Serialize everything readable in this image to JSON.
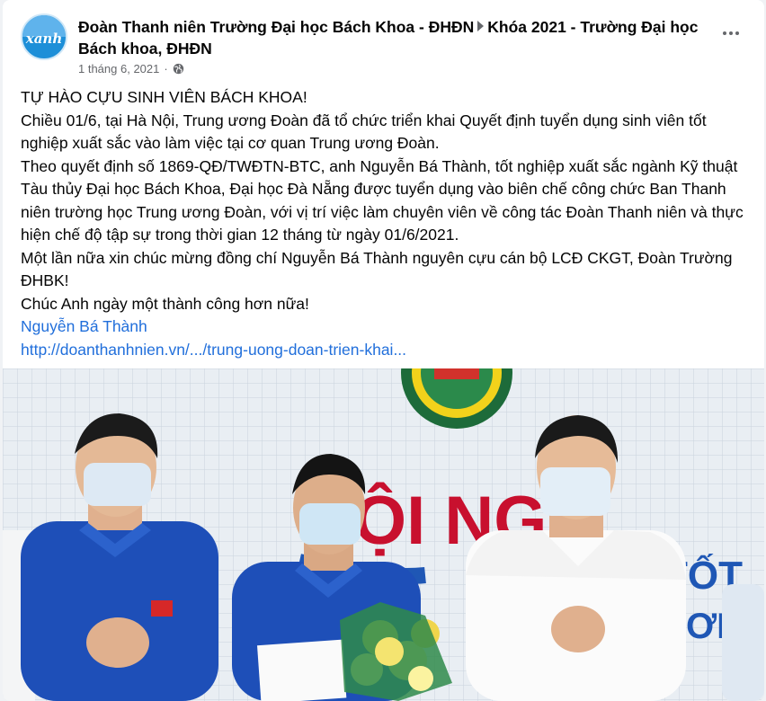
{
  "post": {
    "author": "Đoàn Thanh niên Trường Đại học Bách Khoa - ĐHĐN",
    "group": "Khóa 2021 - Trường Đại học Bách khoa, ĐHĐN",
    "avatar_text": "xanh",
    "date": "1 tháng 6, 2021",
    "dot": "·",
    "privacy_icon": "globe-icon",
    "more_icon": "more-options-icon",
    "lines": [
      "TỰ HÀO CỰU SINH VIÊN BÁCH KHOA!",
      "Chiều 01/6, tại Hà Nội, Trung ương Đoàn đã tổ chức triển khai Quyết định tuyển dụng sinh viên tốt nghiệp xuất sắc vào làm việc tại cơ quan Trung ương Đoàn.",
      "Theo quyết định số 1869-QĐ/TWĐTN-BTC, anh Nguyễn Bá Thành, tốt nghiệp xuất sắc ngành Kỹ thuật Tàu thủy Đại học Bách Khoa, Đại học Đà Nẵng được tuyển dụng vào biên chế công chức Ban Thanh niên trường học Trung ương Đoàn, với vị trí việc làm chuyên viên về công tác Đoàn Thanh niên  và thực hiện chế độ tập sự trong thời gian 12 tháng từ ngày 01/6/2021.",
      "Một lần nữa xin chúc mừng đồng chí Nguyễn Bá Thành nguyên cựu cán bộ LCĐ CKGT, Đoàn Trường ĐHBK!",
      "Chúc Anh ngày một thành công hơn nữa!"
    ],
    "tag": "Nguyễn Bá Thành",
    "link": "http://doanthanhnien.vn/.../trung-uong-doan-trien-khai...",
    "banner_text": "ỘI NGH",
    "banner_text2": "TỐT",
    "banner_text3": "ƠN",
    "colors": {
      "link": "#216fdb",
      "text": "#050505",
      "meta": "#65676b",
      "shirt_blue": "#1e4fb8",
      "banner_red": "#c8102e"
    }
  }
}
